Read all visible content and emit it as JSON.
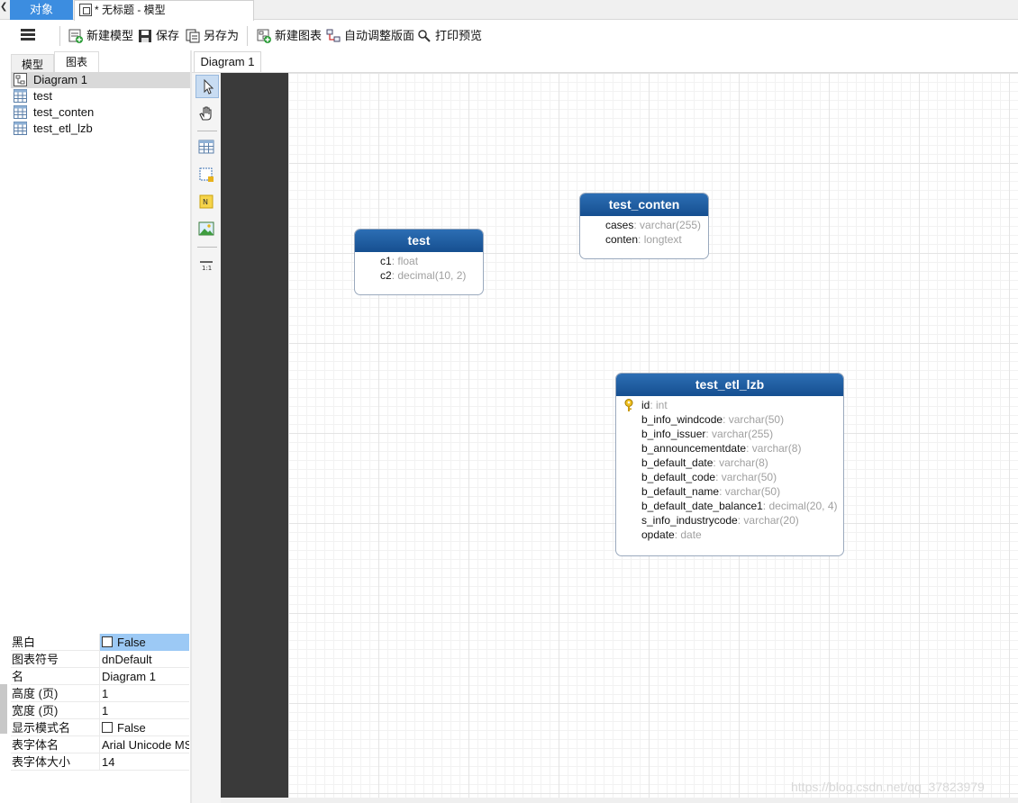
{
  "tabs": {
    "object_tab": "对象",
    "model_tab": "* 无标题 - 模型"
  },
  "toolbar": {
    "new_model": "新建模型",
    "save": "保存",
    "save_as": "另存为",
    "new_diagram": "新建图表",
    "auto_layout": "自动调整版面",
    "print_preview": "打印预览"
  },
  "left_panel": {
    "tab_model": "模型",
    "tab_chart": "图表",
    "tree": [
      "Diagram 1",
      "test",
      "test_conten",
      "test_etl_lzb"
    ]
  },
  "properties": [
    {
      "name": "黑白",
      "value": "False",
      "checkbox": true
    },
    {
      "name": "图表符号",
      "value": "dnDefault"
    },
    {
      "name": "名",
      "value": "Diagram 1"
    },
    {
      "name": "高度 (页)",
      "value": "1"
    },
    {
      "name": "宽度 (页)",
      "value": "1"
    },
    {
      "name": "显示模式名",
      "value": "False",
      "checkbox": true
    },
    {
      "name": "表字体名",
      "value": "Arial Unicode MS"
    },
    {
      "name": "表字体大小",
      "value": "14"
    }
  ],
  "diagram_tab": "Diagram 1",
  "palette_zoom_label": "1:1",
  "entities": {
    "test": {
      "name": "test",
      "fields": [
        {
          "name": "c1",
          "type": ": float"
        },
        {
          "name": "c2",
          "type": ": decimal(10, 2)"
        }
      ]
    },
    "test_conten": {
      "name": "test_conten",
      "fields": [
        {
          "name": "cases",
          "type": ": varchar(255)"
        },
        {
          "name": "conten",
          "type": ": longtext"
        }
      ]
    },
    "test_etl_lzb": {
      "name": "test_etl_lzb",
      "fields": [
        {
          "name": "id",
          "type": ": int",
          "key": true
        },
        {
          "name": "b_info_windcode",
          "type": ": varchar(50)"
        },
        {
          "name": "b_info_issuer",
          "type": ": varchar(255)"
        },
        {
          "name": "b_announcementdate",
          "type": ": varchar(8)"
        },
        {
          "name": "b_default_date",
          "type": ": varchar(8)"
        },
        {
          "name": "b_default_code",
          "type": ": varchar(50)"
        },
        {
          "name": "b_default_name",
          "type": ": varchar(50)"
        },
        {
          "name": "b_default_date_balance1",
          "type": ": decimal(20, 4)"
        },
        {
          "name": "s_info_industrycode",
          "type": ": varchar(20)"
        },
        {
          "name": "opdate",
          "type": ": date"
        }
      ]
    }
  },
  "watermark": "https://blog.csdn.net/qq_37823979",
  "colors": {
    "accent": "#3c8de0",
    "entity_header": "#1d5b9f",
    "selection": "#9cc9f5"
  }
}
